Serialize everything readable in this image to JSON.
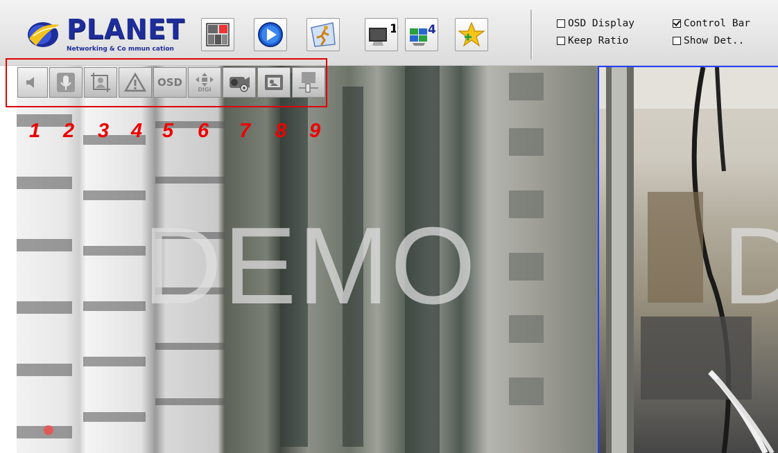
{
  "brand": {
    "name": "PLANET",
    "tagline": "Networking & Co mmun cation"
  },
  "toolbar": {
    "buttons": [
      {
        "name": "layout-grid",
        "icon": "grid-layout-icon"
      },
      {
        "name": "play",
        "icon": "play-icon"
      },
      {
        "name": "motion",
        "icon": "running-person-icon"
      },
      {
        "name": "single-view",
        "icon": "monitor-1-icon",
        "badge": "1"
      },
      {
        "name": "quad-view",
        "icon": "monitor-4-icon",
        "badge": "4"
      },
      {
        "name": "add-favorite",
        "icon": "star-plus-icon"
      }
    ]
  },
  "options": {
    "osd_display": {
      "label": "OSD Display",
      "checked": false
    },
    "control_bar": {
      "label": "Control Bar",
      "checked": true
    },
    "keep_ratio": {
      "label": "Keep Ratio",
      "checked": false
    },
    "show_det": {
      "label": "Show Det..",
      "checked": false
    }
  },
  "control_bar": {
    "buttons": [
      {
        "name": "speaker",
        "icon": "speaker-icon"
      },
      {
        "name": "microphone",
        "icon": "microphone-icon"
      },
      {
        "name": "snapshot-frame",
        "icon": "person-frame-icon"
      },
      {
        "name": "alarm",
        "icon": "warning-icon"
      },
      {
        "name": "osd",
        "icon": "osd-text-icon",
        "label": "OSD"
      },
      {
        "name": "digital-ptz",
        "icon": "digi-move-icon",
        "label": "DIGI"
      },
      {
        "name": "record",
        "icon": "camcorder-icon"
      },
      {
        "name": "capture",
        "icon": "camera-capture-icon"
      },
      {
        "name": "image-adjust",
        "icon": "slider-icon"
      }
    ],
    "annotation_numbers": [
      "1",
      "2",
      "3",
      "4",
      "5",
      "6",
      "7",
      "8",
      "9"
    ]
  },
  "video": {
    "watermark_left": "DEMO",
    "watermark_right": "D"
  },
  "colors": {
    "annotation": "#ee0000",
    "brand_blue": "#1d2d9a",
    "selected_pane_border": "#2040ff"
  }
}
